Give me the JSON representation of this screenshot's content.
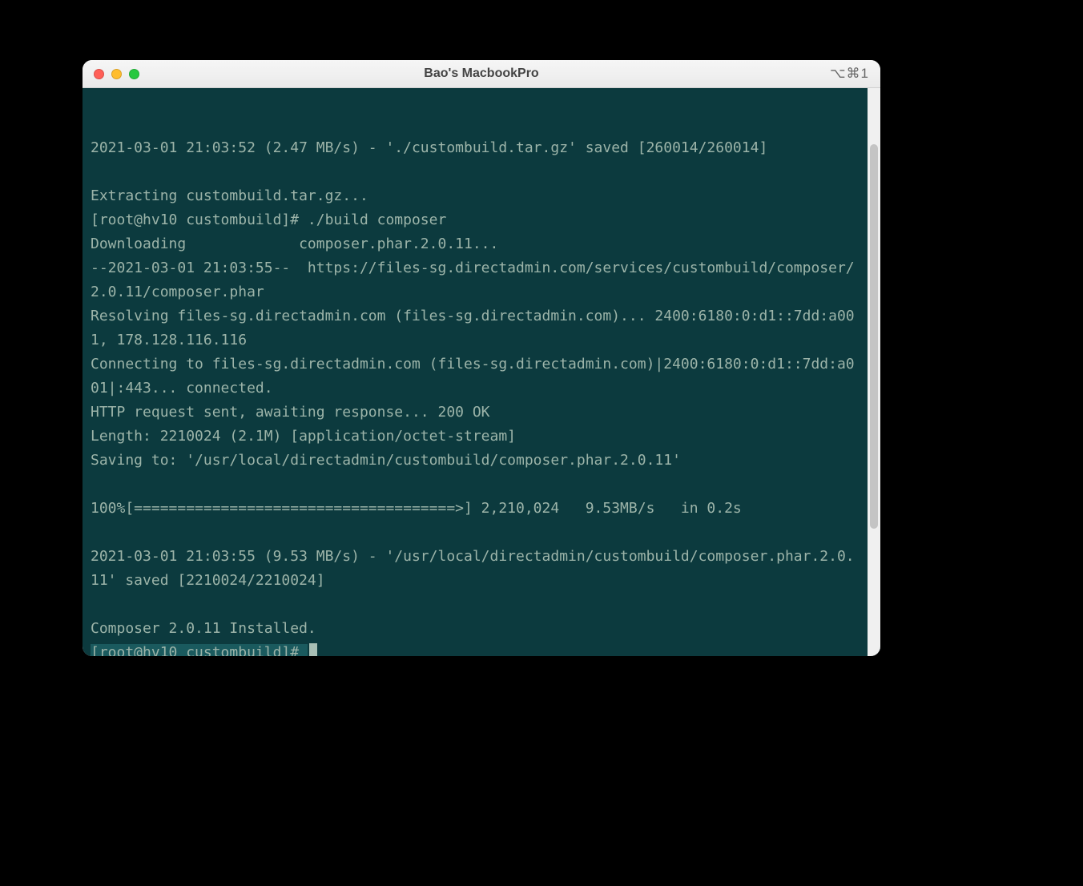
{
  "window": {
    "title": "Bao's MacbookPro",
    "shortcut": "⌥⌘1"
  },
  "terminal": {
    "lines": [
      "",
      "2021-03-01 21:03:52 (2.47 MB/s) - './custombuild.tar.gz' saved [260014/260014]",
      "",
      "Extracting custombuild.tar.gz...",
      "[root@hv10 custombuild]# ./build composer",
      "Downloading             composer.phar.2.0.11...",
      "--2021-03-01 21:03:55--  https://files-sg.directadmin.com/services/custombuild/composer/2.0.11/composer.phar",
      "Resolving files-sg.directadmin.com (files-sg.directadmin.com)... 2400:6180:0:d1::7dd:a001, 178.128.116.116",
      "Connecting to files-sg.directadmin.com (files-sg.directadmin.com)|2400:6180:0:d1::7dd:a001|:443... connected.",
      "HTTP request sent, awaiting response... 200 OK",
      "Length: 2210024 (2.1M) [application/octet-stream]",
      "Saving to: '/usr/local/directadmin/custombuild/composer.phar.2.0.11'",
      "",
      "100%[=====================================>] 2,210,024   9.53MB/s   in 0.2s",
      "",
      "2021-03-01 21:03:55 (9.53 MB/s) - '/usr/local/directadmin/custombuild/composer.phar.2.0.11' saved [2210024/2210024]",
      "",
      "Composer 2.0.11 Installed."
    ],
    "prompt": "[root@hv10 custombuild]# "
  }
}
